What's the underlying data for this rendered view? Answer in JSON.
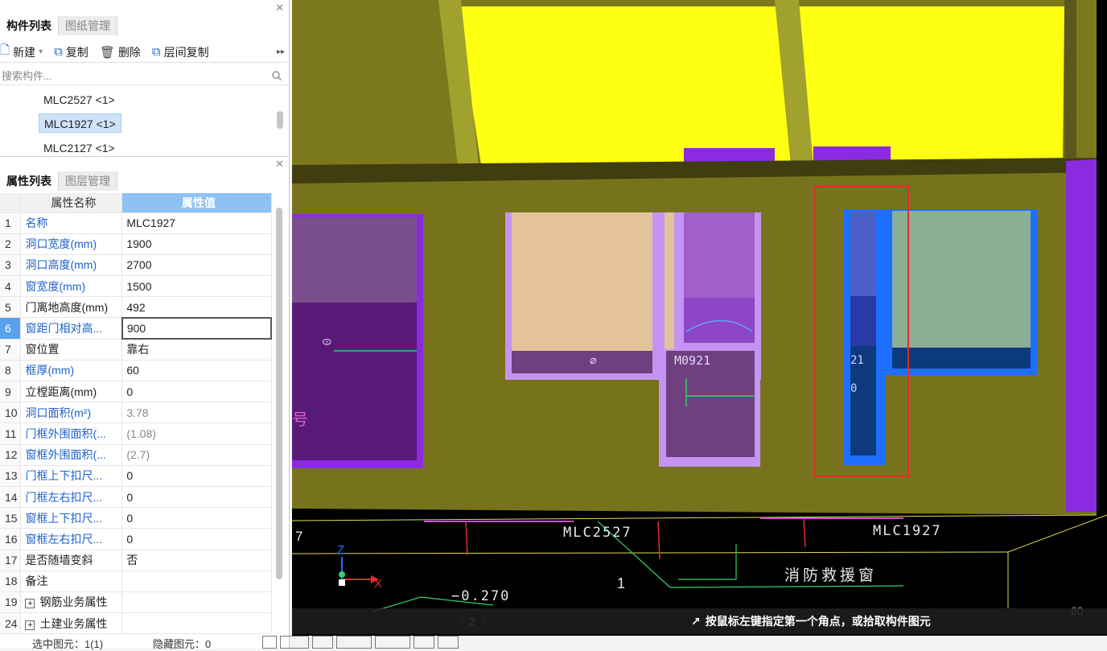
{
  "component_panel": {
    "tabs": [
      "构件列表",
      "图纸管理"
    ],
    "toolbar": {
      "new": "新建",
      "copy": "复制",
      "delete": "删除",
      "floor_copy": "层间复制"
    },
    "search_placeholder": "搜索构件...",
    "items": [
      "MLC2527 <1>",
      "MLC1927 <1>",
      "MLC2127 <1>"
    ],
    "selected": "MLC1927 <1>"
  },
  "property_panel": {
    "tabs": [
      "属性列表",
      "图层管理"
    ],
    "col_name": "属性名称",
    "col_value": "属性值",
    "rows": [
      {
        "num": "1",
        "name": "名称",
        "value": "MLC1927"
      },
      {
        "num": "2",
        "name": "洞口宽度(mm)",
        "value": "1900"
      },
      {
        "num": "3",
        "name": "洞口高度(mm)",
        "value": "2700"
      },
      {
        "num": "4",
        "name": "窗宽度(mm)",
        "value": "1500"
      },
      {
        "num": "5",
        "name": "门离地高度(mm)",
        "value": "492"
      },
      {
        "num": "6",
        "name": "窗距门相对高...",
        "value": "900"
      },
      {
        "num": "7",
        "name": "窗位置",
        "value": "靠右"
      },
      {
        "num": "8",
        "name": "框厚(mm)",
        "value": "60"
      },
      {
        "num": "9",
        "name": "立樘距离(mm)",
        "value": "0"
      },
      {
        "num": "10",
        "name": "洞口面积(m²)",
        "value": "3.78"
      },
      {
        "num": "11",
        "name": "门框外围面积(...",
        "value": "(1.08)"
      },
      {
        "num": "12",
        "name": "窗框外围面积(...",
        "value": "(2.7)"
      },
      {
        "num": "13",
        "name": "门框上下扣尺...",
        "value": "0"
      },
      {
        "num": "14",
        "name": "门框左右扣尺...",
        "value": "0"
      },
      {
        "num": "15",
        "name": "窗框上下扣尺...",
        "value": "0"
      },
      {
        "num": "16",
        "name": "窗框左右扣尺...",
        "value": "0"
      },
      {
        "num": "17",
        "name": "是否随墙变斜",
        "value": "否"
      },
      {
        "num": "18",
        "name": "备注",
        "value": ""
      },
      {
        "num": "19",
        "name": "钢筋业务属性",
        "value": ""
      },
      {
        "num": "24",
        "name": "土建业务属性",
        "value": ""
      }
    ]
  },
  "viewport": {
    "labels": {
      "m0921": "M0921",
      "mlc2527": "MLC2527",
      "mlc1927": "MLC1927",
      "fire_window": "消防救援窗",
      "elev": "−0.270",
      "grid1": "1",
      "grid2": "2",
      "seven": "7",
      "sixty": "60",
      "partial21": "21",
      "vert_label": "0",
      "vert_label2": "0",
      "hao": "号",
      "axis_x": "X",
      "axis_z": "Z"
    },
    "hint": "按鼠标左键指定第一个角点，或拾取构件图元"
  },
  "status": {
    "selected": "选中图元：1(1)",
    "hidden": "隐藏图元：0"
  },
  "colors": {
    "wall": "#77731d",
    "yellow": "#ffff12",
    "purple": "#6e2a92",
    "blue": "#1e6fff",
    "accent": "#8fc2f4"
  }
}
